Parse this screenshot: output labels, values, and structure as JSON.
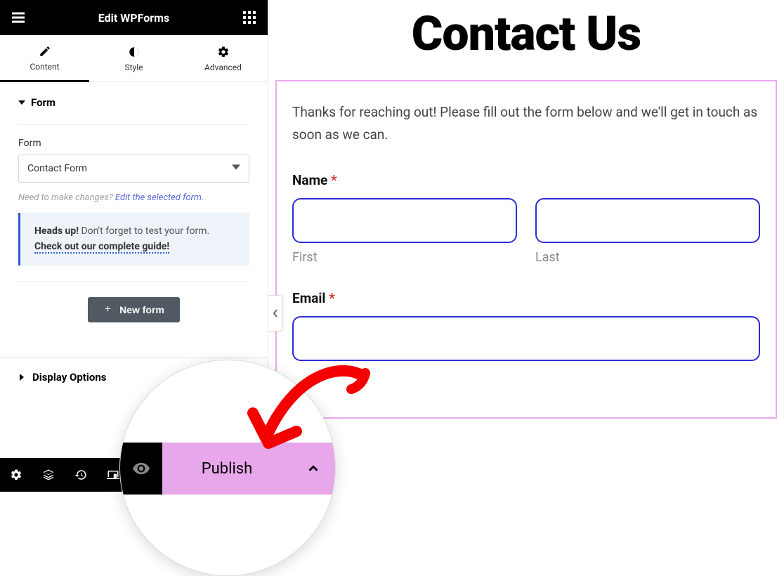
{
  "topbar": {
    "title": "Edit WPForms"
  },
  "tabs": {
    "content": "Content",
    "style": "Style",
    "advanced": "Advanced"
  },
  "section": {
    "form_heading": "Form",
    "form_label": "Form",
    "select_value": "Contact Form",
    "hint_prefix": "Need to make changes? ",
    "hint_link": "Edit the selected form.",
    "notice_strong": "Heads up!",
    "notice_text": " Don't forget to test your form. ",
    "notice_link": "Check out our complete guide!",
    "new_form_btn": "New form",
    "display_options": "Display Options"
  },
  "bottom": {
    "publish": "Publish"
  },
  "canvas": {
    "heading": "Contact Us",
    "intro": "Thanks for reaching out! Please fill out the form below and we'll get in touch as soon as we can.",
    "name_label": "Name",
    "first_sub": "First",
    "last_sub": "Last",
    "email_label": "Email",
    "required_mark": "*"
  }
}
